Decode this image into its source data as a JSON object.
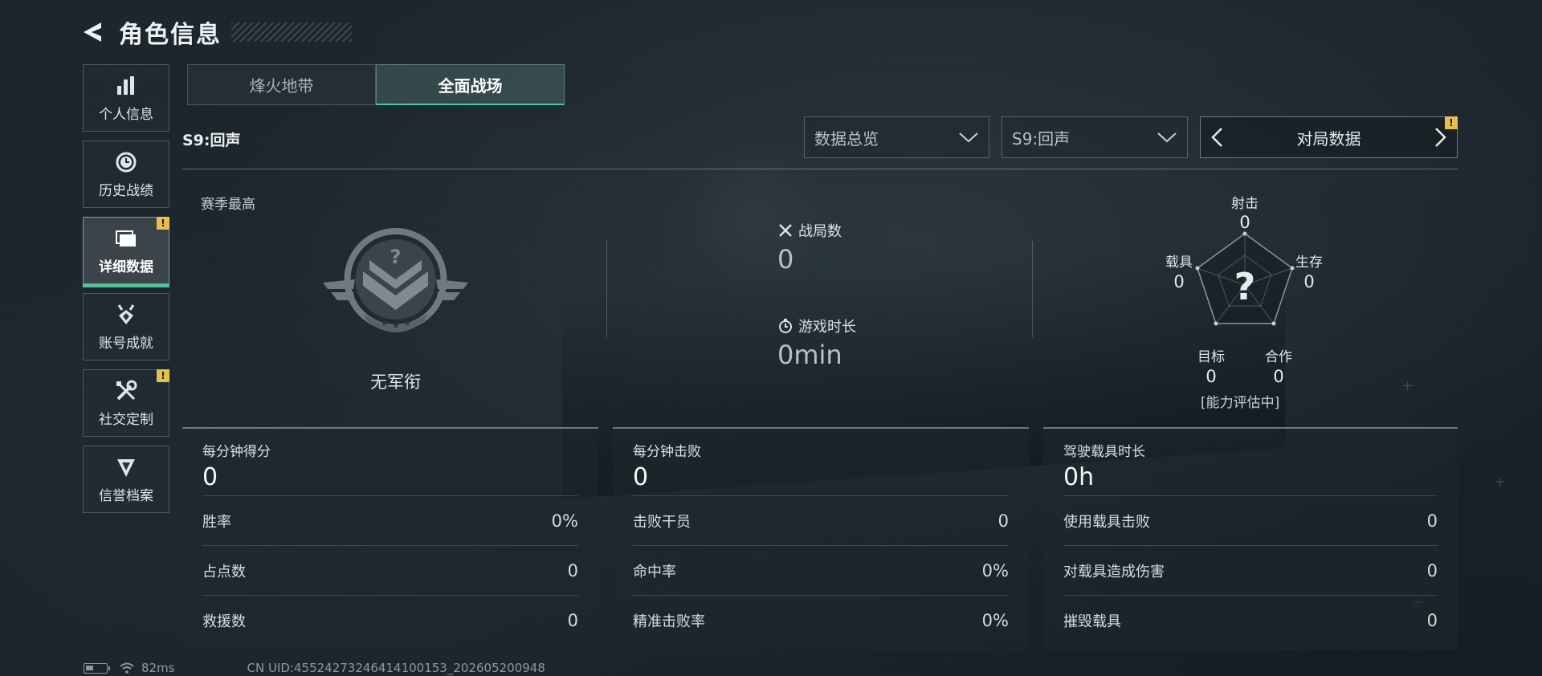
{
  "header": {
    "title": "角色信息"
  },
  "sidebar": {
    "items": [
      {
        "label": "个人信息",
        "icon": "bar-chart-icon",
        "active": false,
        "alert": false
      },
      {
        "label": "历史战绩",
        "icon": "history-clock-icon",
        "active": false,
        "alert": false
      },
      {
        "label": "详细数据",
        "icon": "folder-icon",
        "active": true,
        "alert": true
      },
      {
        "label": "账号成就",
        "icon": "medal-icon",
        "active": false,
        "alert": false
      },
      {
        "label": "社交定制",
        "icon": "tools-icon",
        "active": false,
        "alert": true
      },
      {
        "label": "信誉档案",
        "icon": "shield-badge-icon",
        "active": false,
        "alert": false
      }
    ]
  },
  "mode_tabs": [
    {
      "label": "烽火地带",
      "active": false
    },
    {
      "label": "全面战场",
      "active": true
    }
  ],
  "season": {
    "label": "S9:回声",
    "dropdown_view": "数据总览",
    "dropdown_season": "S9:回声",
    "stepper_label": "对局数据"
  },
  "overview": {
    "season_high_label": "赛季最高",
    "rank_name": "无军衔",
    "matches_label": "战局数",
    "matches_value": "0",
    "playtime_label": "游戏时长",
    "playtime_value": "0min"
  },
  "radar": {
    "center_mark": "?",
    "status": "[能力评估中]",
    "axes": [
      {
        "label": "射击",
        "value": "0"
      },
      {
        "label": "生存",
        "value": "0"
      },
      {
        "label": "合作",
        "value": "0"
      },
      {
        "label": "目标",
        "value": "0"
      },
      {
        "label": "载具",
        "value": "0"
      }
    ]
  },
  "cards": [
    {
      "title": "每分钟得分",
      "value": "0",
      "rows": [
        {
          "label": "胜率",
          "value": "0%"
        },
        {
          "label": "占点数",
          "value": "0"
        },
        {
          "label": "救援数",
          "value": "0"
        }
      ]
    },
    {
      "title": "每分钟击败",
      "value": "0",
      "rows": [
        {
          "label": "击败干员",
          "value": "0"
        },
        {
          "label": "命中率",
          "value": "0%"
        },
        {
          "label": "精准击败率",
          "value": "0%"
        }
      ]
    },
    {
      "title": "驾驶载具时长",
      "value": "0h",
      "rows": [
        {
          "label": "使用载具击败",
          "value": "0"
        },
        {
          "label": "对载具造成伤害",
          "value": "0"
        },
        {
          "label": "摧毁载具",
          "value": "0"
        }
      ]
    }
  ],
  "footer": {
    "ping": "82ms",
    "uid": "CN UID:4552427324641410015­3_202605200948"
  },
  "colors": {
    "accent": "#4ec59a",
    "alert": "#e5c04a"
  }
}
